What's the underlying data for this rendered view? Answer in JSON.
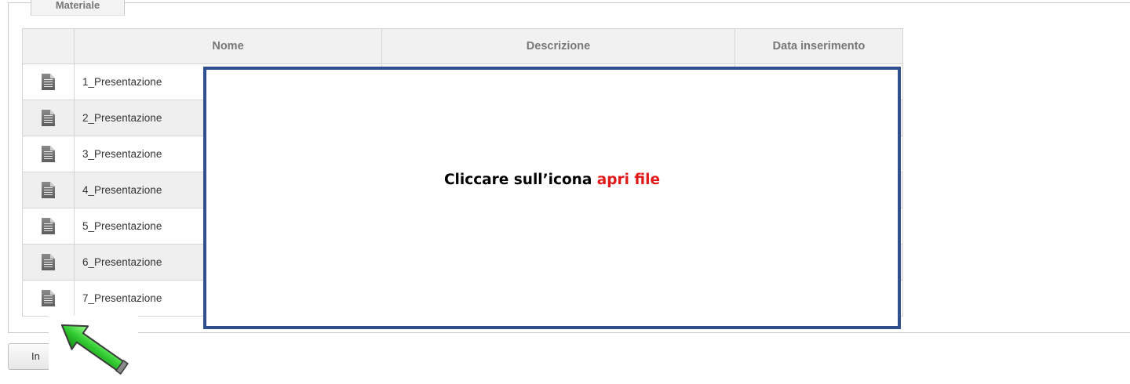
{
  "panel": {
    "title": "Materiale"
  },
  "table": {
    "headers": {
      "icon": "",
      "name": "Nome",
      "description": "Descrizione",
      "date": "Data inserimento"
    },
    "rows": [
      {
        "name": "1_Presentazione"
      },
      {
        "name": "2_Presentazione"
      },
      {
        "name": "3_Presentazione"
      },
      {
        "name": "4_Presentazione"
      },
      {
        "name": "5_Presentazione"
      },
      {
        "name": "6_Presentazione"
      },
      {
        "name": "7_Presentazione"
      }
    ],
    "row_icon": "document-icon"
  },
  "bottom_button": {
    "label": "In"
  },
  "callout": {
    "text_before": "Cliccare sull’icona ",
    "text_highlight": "apri file",
    "border_color": "#2f4f8f",
    "highlight_color": "#e11919"
  },
  "pointer": {
    "icon": "green-arrow-icon",
    "color": "#33cc33"
  }
}
